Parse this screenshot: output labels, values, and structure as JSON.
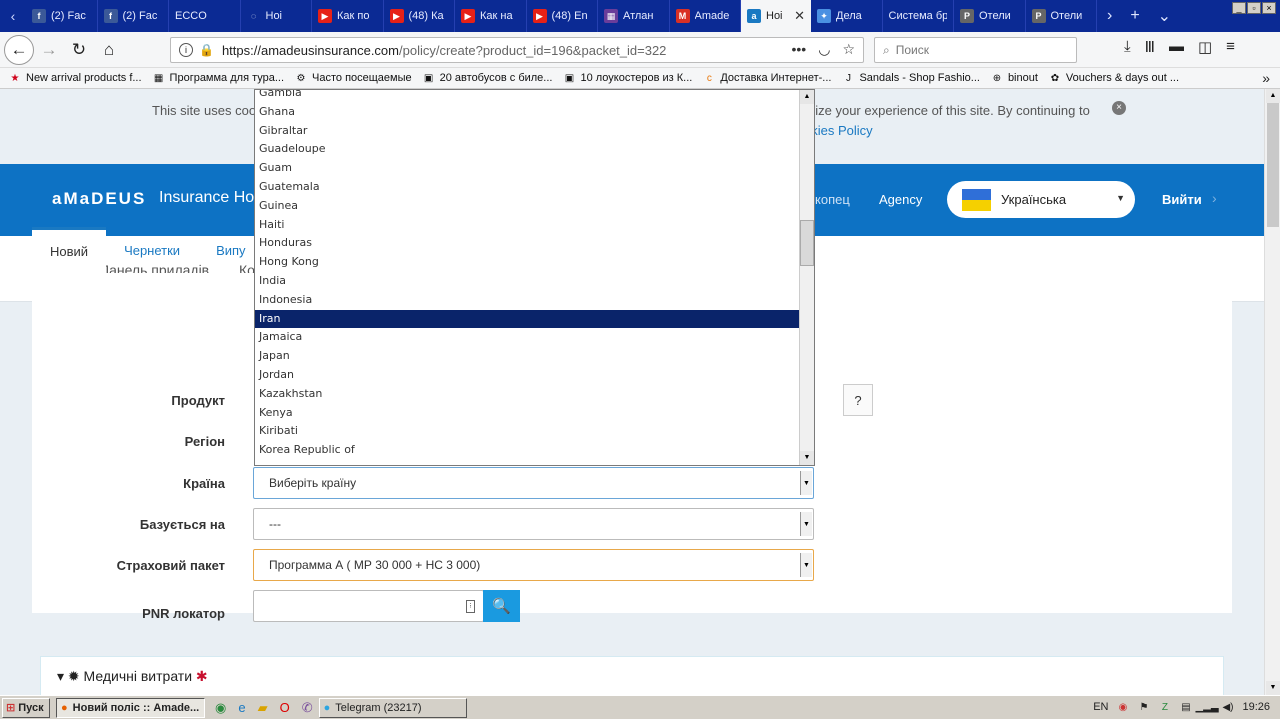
{
  "browser": {
    "tabs": [
      {
        "label": "(2) Fac",
        "icon": "facebook-icon",
        "color": "#3b5998",
        "glyph": "f"
      },
      {
        "label": "(2) Fac",
        "icon": "facebook-icon",
        "color": "#3b5998",
        "glyph": "f"
      },
      {
        "label": "ECCO",
        "icon": "",
        "color": "",
        "glyph": ""
      },
      {
        "label": "Hoi",
        "icon": "loading-icon",
        "color": "#0b2a94",
        "glyph": "◌"
      },
      {
        "label": "Как по",
        "icon": "youtube-icon",
        "color": "#e62117",
        "glyph": "▶"
      },
      {
        "label": "(48) Ка",
        "icon": "youtube-icon",
        "color": "#e62117",
        "glyph": "▶"
      },
      {
        "label": "Как на",
        "icon": "youtube-icon",
        "color": "#e62117",
        "glyph": "▶"
      },
      {
        "label": "(48) En",
        "icon": "youtube-icon",
        "color": "#e62117",
        "glyph": "▶"
      },
      {
        "label": "Атлан",
        "icon": "site-icon",
        "color": "#6a3d9a",
        "glyph": "▦"
      },
      {
        "label": "Amade",
        "icon": "gmail-icon",
        "color": "#d93025",
        "glyph": "M"
      },
      {
        "label": "Hoi",
        "icon": "amadeus-icon",
        "color": "#1a79c2",
        "glyph": "a"
      },
      {
        "label": "Дела",
        "icon": "site-icon",
        "color": "#4a90e2",
        "glyph": "✦"
      },
      {
        "label": "Система бр",
        "icon": "",
        "color": "",
        "glyph": ""
      },
      {
        "label": "Отели",
        "icon": "pac-icon",
        "color": "#666",
        "glyph": "P"
      },
      {
        "label": "Отели",
        "icon": "pac-icon",
        "color": "#666",
        "glyph": "P"
      }
    ],
    "url_host": "https://amadeusinsurance.com",
    "url_path": "/policy/create?product_id=196&packet_id=322",
    "search_placeholder": "Поиск",
    "bookmarks": [
      {
        "label": "New arrival products f...",
        "glyph": "★"
      },
      {
        "label": "Программа для тура...",
        "glyph": "▦"
      },
      {
        "label": "Часто посещаемые",
        "glyph": "⚙"
      },
      {
        "label": "20 автобусов с биле...",
        "glyph": "▣"
      },
      {
        "label": "10 лоукостеров из К...",
        "glyph": "▣"
      },
      {
        "label": "Доставка Интернет-...",
        "glyph": "c"
      },
      {
        "label": "Sandals - Shop Fashio...",
        "glyph": "J"
      },
      {
        "label": "binout",
        "glyph": "⊕"
      },
      {
        "label": "Vouchers & days out ...",
        "glyph": "✿"
      }
    ]
  },
  "cookie": {
    "text_left": "This site uses coo",
    "text_right": "nize your experience of this site. By continuing to",
    "link": "okies Policy"
  },
  "header": {
    "logo": "aMaDEUS",
    "brand": "Insurance Ho",
    "link1": "копец",
    "link2": "Agency",
    "language": "Українська",
    "logout": "Вийти"
  },
  "subnav": {
    "item1": "Панель приладів",
    "item2": "Ко"
  },
  "tabs": [
    "Новий",
    "Чернетки",
    "Випу"
  ],
  "form": {
    "product_label": "Продукт",
    "region_label": "Регіон",
    "country_label": "Країна",
    "country_value": "Виберіть країну",
    "based_label": "Базується на",
    "based_value": "---",
    "package_label": "Страховий пакет",
    "package_value": "Программа А ( МР 30 000 + НС 3 000)",
    "pnr_label": "PNR локатор",
    "help": "?"
  },
  "section": {
    "title": "Медичні витрати"
  },
  "dropdown": {
    "items": [
      "Gambia",
      "Ghana",
      "Gibraltar",
      "Guadeloupe",
      "Guam",
      "Guatemala",
      "Guinea",
      "Haiti",
      "Honduras",
      "Hong Kong",
      "India",
      "Indonesia",
      "Iran",
      "Jamaica",
      "Japan",
      "Jordan",
      "Kazakhstan",
      "Kenya",
      "Kiribati",
      "Korea Republic of"
    ],
    "selected": "Iran"
  },
  "taskbar": {
    "start": "Пуск",
    "active": "Новий поліс :: Amade...",
    "telegram": "Telegram (23217)",
    "lang": "EN",
    "clock": "19:26"
  },
  "colors": {
    "brand_blue": "#0d72c4",
    "tab_bar": "#0b2a94",
    "selection": "#0a246a",
    "search_button": "#1a9ae0"
  }
}
